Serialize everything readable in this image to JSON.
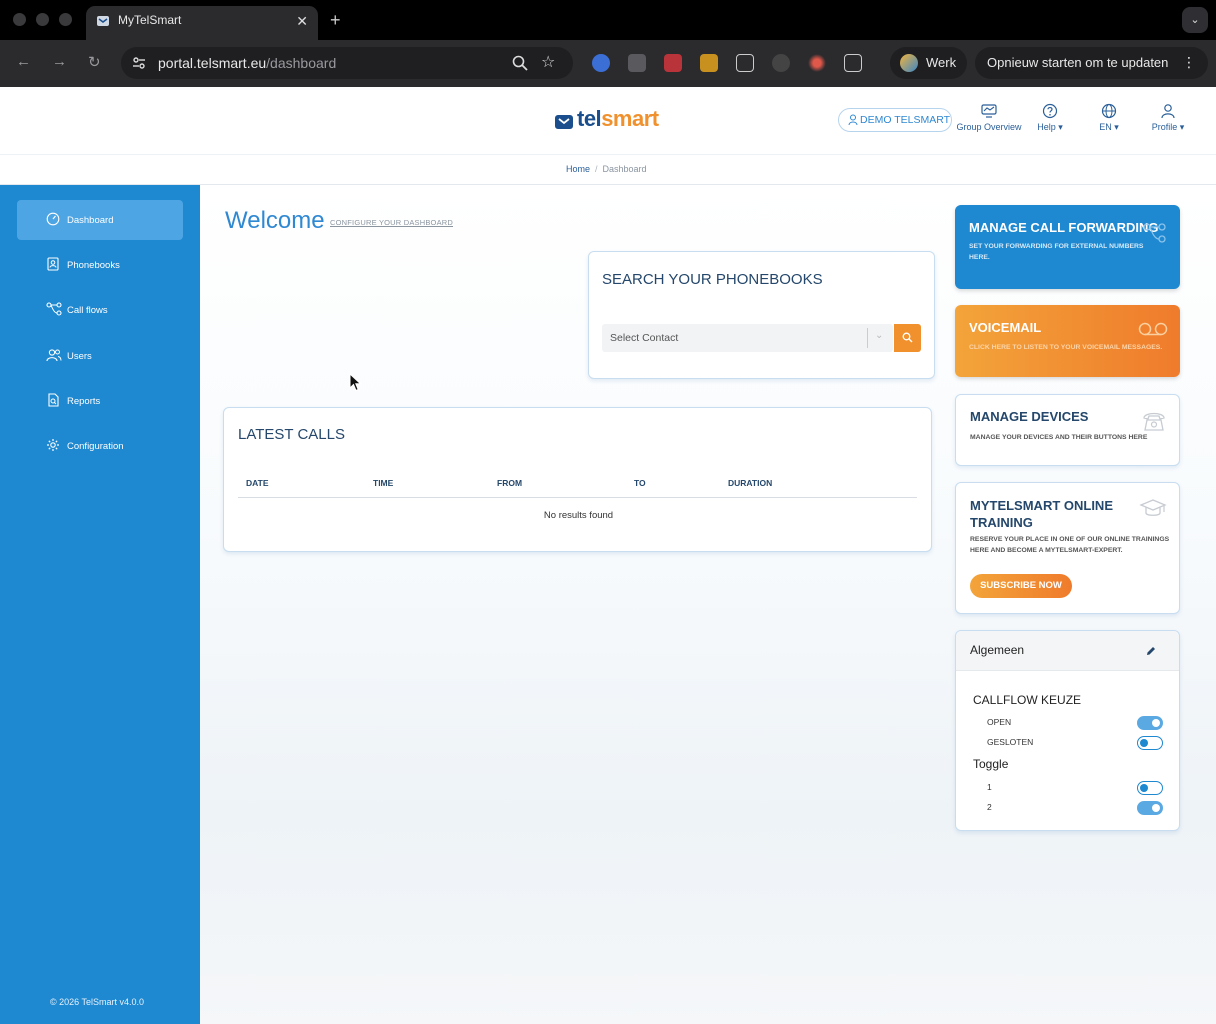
{
  "browser": {
    "tab_title": "MyTelSmart",
    "new_tab_symbol": "+",
    "url_host": "portal.telsmart.eu",
    "url_path": "/dashboard",
    "profile_chip_label": "Werk",
    "update_chip_label": "Opnieuw starten om te updaten",
    "colors": {
      "tabstrip": "#000000",
      "toolbar": "#2b2b2e"
    }
  },
  "header": {
    "logo_tel": "tel",
    "logo_smart": "smart",
    "account_button": "DEMO TELSMART",
    "nav": [
      {
        "label": "Group Overview",
        "icon": "group-overview-icon"
      },
      {
        "label": "Help ▾",
        "icon": "help-circle-icon"
      },
      {
        "label": "EN ▾",
        "icon": "globe-icon"
      },
      {
        "label": "Profile ▾",
        "icon": "user-icon"
      }
    ]
  },
  "breadcrumb": {
    "home": "Home",
    "separator": "/",
    "current": "Dashboard"
  },
  "sidebar": {
    "items": [
      {
        "label": "Dashboard",
        "icon": "gauge-icon",
        "active": true
      },
      {
        "label": "Phonebooks",
        "icon": "phonebook-icon",
        "active": false
      },
      {
        "label": "Call flows",
        "icon": "call-flow-icon",
        "active": false
      },
      {
        "label": "Users",
        "icon": "users-icon",
        "active": false
      },
      {
        "label": "Reports",
        "icon": "reports-icon",
        "active": false
      },
      {
        "label": "Configuration",
        "icon": "gear-icon",
        "active": false
      }
    ],
    "footer": "© 2026 TelSmart  v4.0.0"
  },
  "main": {
    "welcome": "Welcome",
    "configure_link": "CONFIGURE YOUR DASHBOARD",
    "search": {
      "title": "SEARCH YOUR PHONEBOOKS",
      "placeholder": "Select Contact"
    },
    "latest_calls": {
      "title": "LATEST CALLS",
      "columns": [
        "DATE",
        "TIME",
        "FROM",
        "TO",
        "DURATION"
      ],
      "empty_text": "No results found"
    }
  },
  "tiles": {
    "forwarding": {
      "title": "MANAGE CALL FORWARDING",
      "desc": "SET YOUR FORWARDING FOR EXTERNAL NUMBERS HERE."
    },
    "voicemail": {
      "title": "VOICEMAIL",
      "desc": "CLICK HERE TO LISTEN TO YOUR VOICEMAIL MESSAGES."
    },
    "devices": {
      "title": "MANAGE DEVICES",
      "desc": "MANAGE YOUR DEVICES AND THEIR BUTTONS HERE"
    },
    "training": {
      "title": "MYTELSMART ONLINE TRAINING",
      "desc": "RESERVE YOUR PLACE IN ONE OF OUR ONLINE TRAININGS HERE AND BECOME A MYTELSMART-EXPERT.",
      "button": "SUBSCRIBE NOW"
    }
  },
  "widget": {
    "title": "Algemeen",
    "groups": [
      {
        "title": "CALLFLOW KEUZE",
        "options": [
          {
            "label": "OPEN",
            "on": true
          },
          {
            "label": "GESLOTEN",
            "on": false
          }
        ]
      },
      {
        "title": "Toggle",
        "options": [
          {
            "label": "1",
            "on": false
          },
          {
            "label": "2",
            "on": true
          }
        ]
      }
    ]
  },
  "colors": {
    "primary": "#1e88d0",
    "accent": "#f0912d",
    "navy": "#24476b"
  }
}
